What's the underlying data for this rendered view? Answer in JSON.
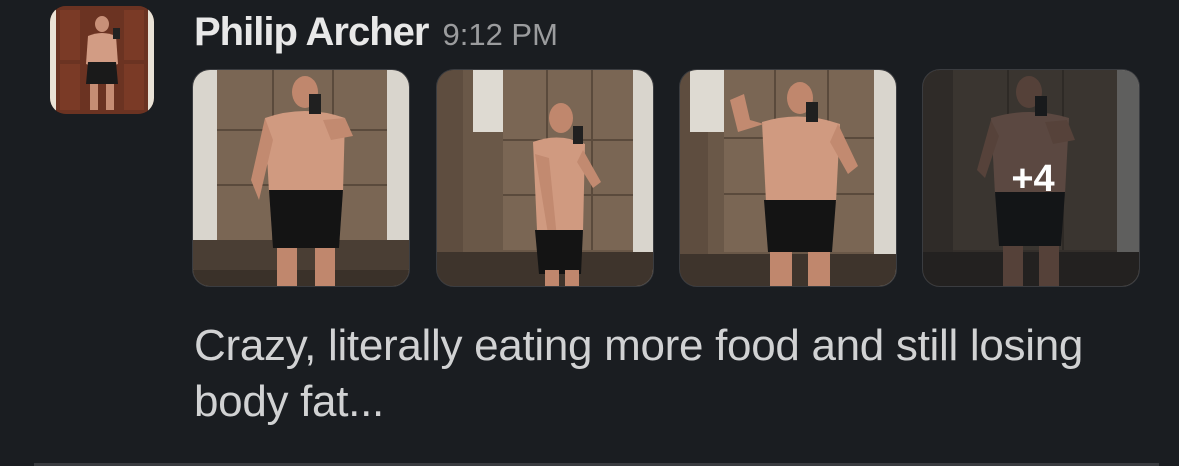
{
  "message": {
    "sender_name": "Philip Archer",
    "timestamp": "9:12 PM",
    "text": "Crazy, literally eating more food and still losing body fat...",
    "attachments": {
      "more_count_label": "+4"
    }
  },
  "icons": {
    "avatar": "profile-photo",
    "attachment_images": "gym-mirror-selfie"
  },
  "colors": {
    "background": "#1a1d21",
    "sender_text": "#e8e8e8",
    "timestamp_text": "#9b9c9e",
    "message_text": "#d1d2d3"
  }
}
